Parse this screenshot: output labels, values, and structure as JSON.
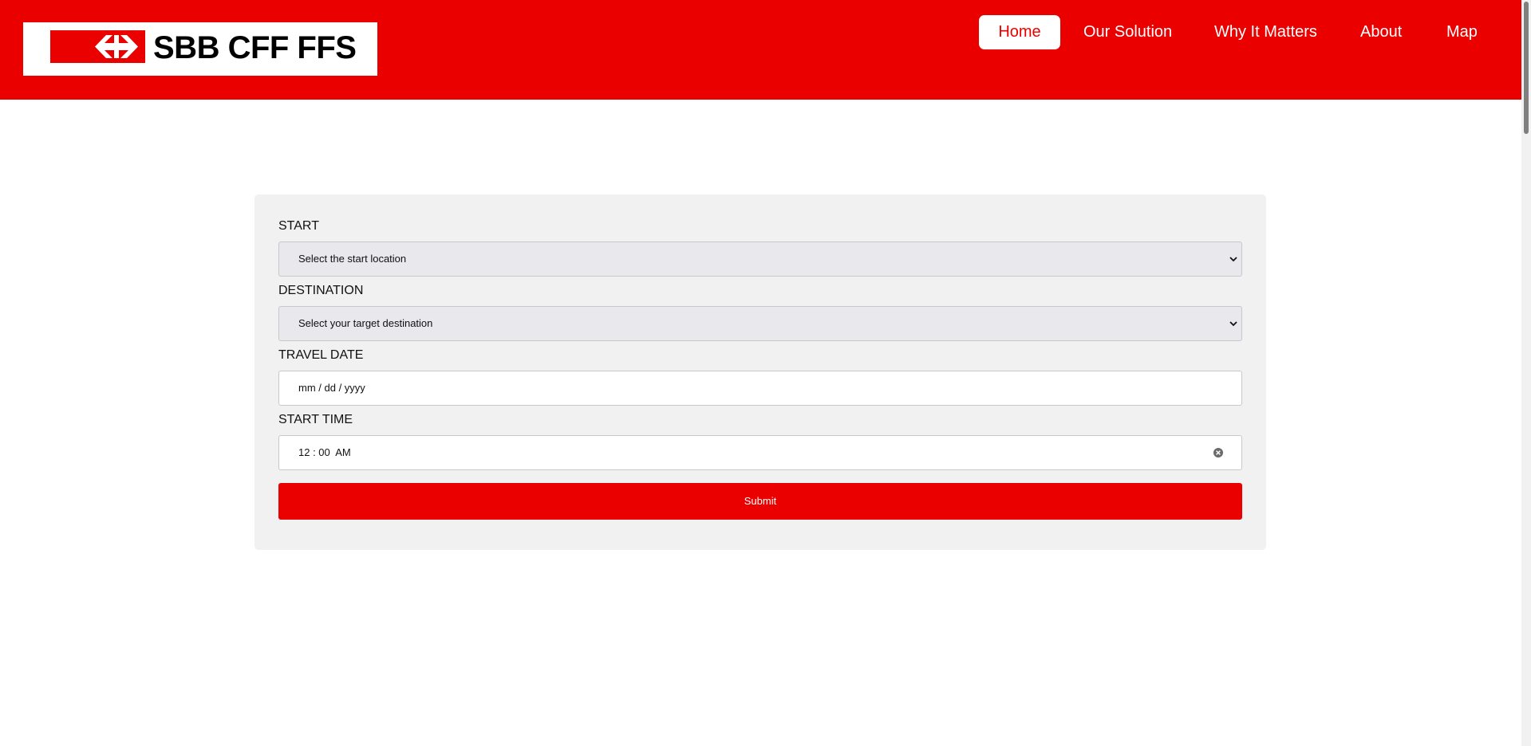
{
  "brand": {
    "name": "SBB CFF FFS",
    "logo_icon": "sbb-double-arrow-icon",
    "color": "#eb0000"
  },
  "nav": {
    "items": [
      {
        "label": "Home",
        "active": true
      },
      {
        "label": "Our Solution",
        "active": false
      },
      {
        "label": "Why It Matters",
        "active": false
      },
      {
        "label": "About",
        "active": false
      },
      {
        "label": "Map",
        "active": false
      }
    ]
  },
  "form": {
    "start": {
      "label": "START",
      "value": "Select the start location"
    },
    "destination": {
      "label": "DESTINATION",
      "value": "Select your target destination"
    },
    "travel_date": {
      "label": "TRAVEL DATE",
      "value": "mm / dd / yyyy"
    },
    "start_time": {
      "label": "START TIME",
      "value": "12 : 00  AM"
    },
    "submit_label": "Submit"
  }
}
